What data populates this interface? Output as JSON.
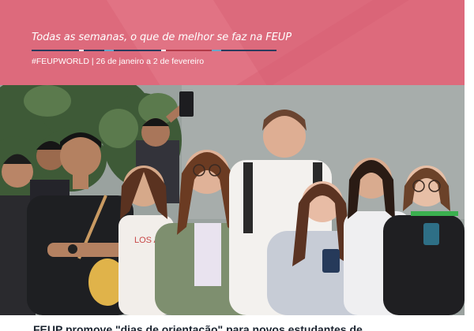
{
  "banner": {
    "tagline": "Todas as semanas, o que de melhor se faz na FEUP",
    "subline": "#FEUPWORLD | 26 de janeiro a 2 de fevereiro",
    "background_color": "#dd6a7c",
    "rule_colors": [
      "#2b3a5c",
      "#ffffff",
      "#2b3a5c",
      "#6aa6c9",
      "#2b3a5c",
      "#ffffff",
      "#b23a48",
      "#6aa6c9",
      "#2b3a5c"
    ]
  },
  "photo": {
    "description_icon": "group-photo-image",
    "shirt_text": "LOS AN"
  },
  "article": {
    "headline": "FEUP promove \"dias de orientação\" para novos estudantes de"
  }
}
